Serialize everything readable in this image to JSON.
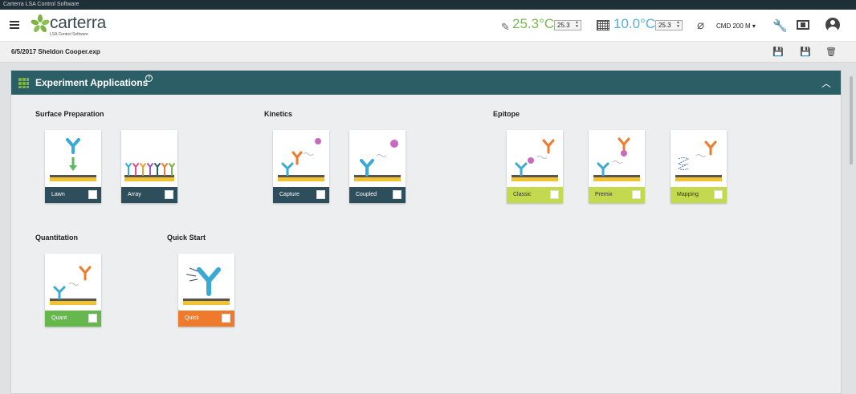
{
  "app": {
    "window_title": "Carterra LSA Control Software",
    "logo_text": "carterra",
    "logo_subtitle": "LSA Control Software"
  },
  "header": {
    "temperature_1": "25.3°C",
    "temperature_1_setpoint": "25.3",
    "temperature_2": "10.0°C",
    "temperature_2_setpoint": "25.3",
    "cmd_label": "CMD 200 M"
  },
  "file": {
    "name": "6/5/2017 Sheldon Cooper.exp"
  },
  "panel": {
    "title": "Experiment Applications",
    "help": "?"
  },
  "sections": {
    "surface_preparation": {
      "title": "Surface Preparation",
      "cards": [
        {
          "label": "Lawn"
        },
        {
          "label": "Array"
        }
      ]
    },
    "kinetics": {
      "title": "Kinetics",
      "cards": [
        {
          "label": "Capture"
        },
        {
          "label": "Coupled"
        }
      ]
    },
    "epitope": {
      "title": "Epitope",
      "cards": [
        {
          "label": "Classic"
        },
        {
          "label": "Premix"
        },
        {
          "label": "Mapping"
        }
      ]
    },
    "quantitation": {
      "title": "Quantitation",
      "cards": [
        {
          "label": "Quant"
        }
      ]
    },
    "quick_start": {
      "title": "Quick Start",
      "cards": [
        {
          "label": "Quick"
        }
      ]
    }
  },
  "colors": {
    "header_teal": "#2c5e66",
    "card_dark": "#2f4e5c",
    "card_lime": "#c3d94e",
    "card_green": "#66b84c",
    "card_orange": "#f07a2b",
    "temp_green": "#77b94a",
    "temp_blue": "#4fb3d9"
  }
}
